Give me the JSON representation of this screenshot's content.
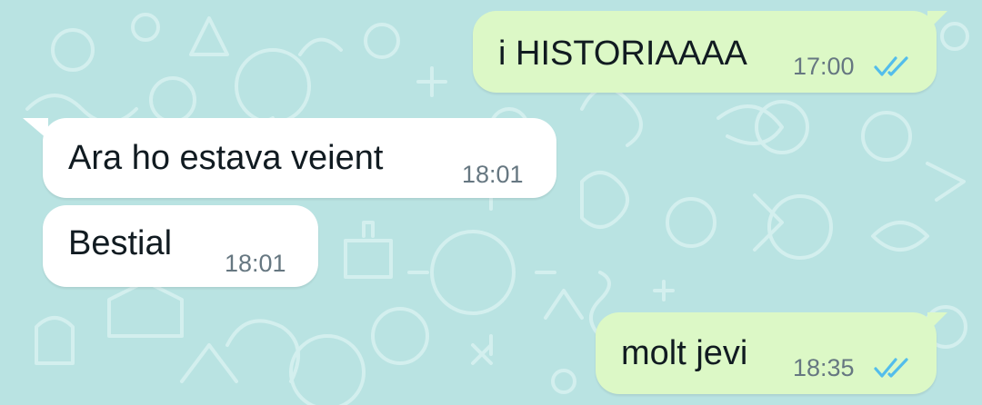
{
  "colors": {
    "wallpaper": "#b9e3e2",
    "outgoing_bubble": "#dcf8c6",
    "incoming_bubble": "#ffffff",
    "text": "#111b21",
    "timestamp": "#667781",
    "read_ticks": "#53bdeb"
  },
  "messages": [
    {
      "direction": "outgoing",
      "text": "i HISTORIAAAA",
      "time": "17:00",
      "status": "read",
      "status_icon": "double-check-icon"
    },
    {
      "direction": "incoming",
      "text": "Ara ho estava veient",
      "time": "18:01"
    },
    {
      "direction": "incoming",
      "text": "Bestial",
      "time": "18:01"
    },
    {
      "direction": "outgoing",
      "text": "molt jevi",
      "time": "18:35",
      "status": "read",
      "status_icon": "double-check-icon"
    }
  ]
}
